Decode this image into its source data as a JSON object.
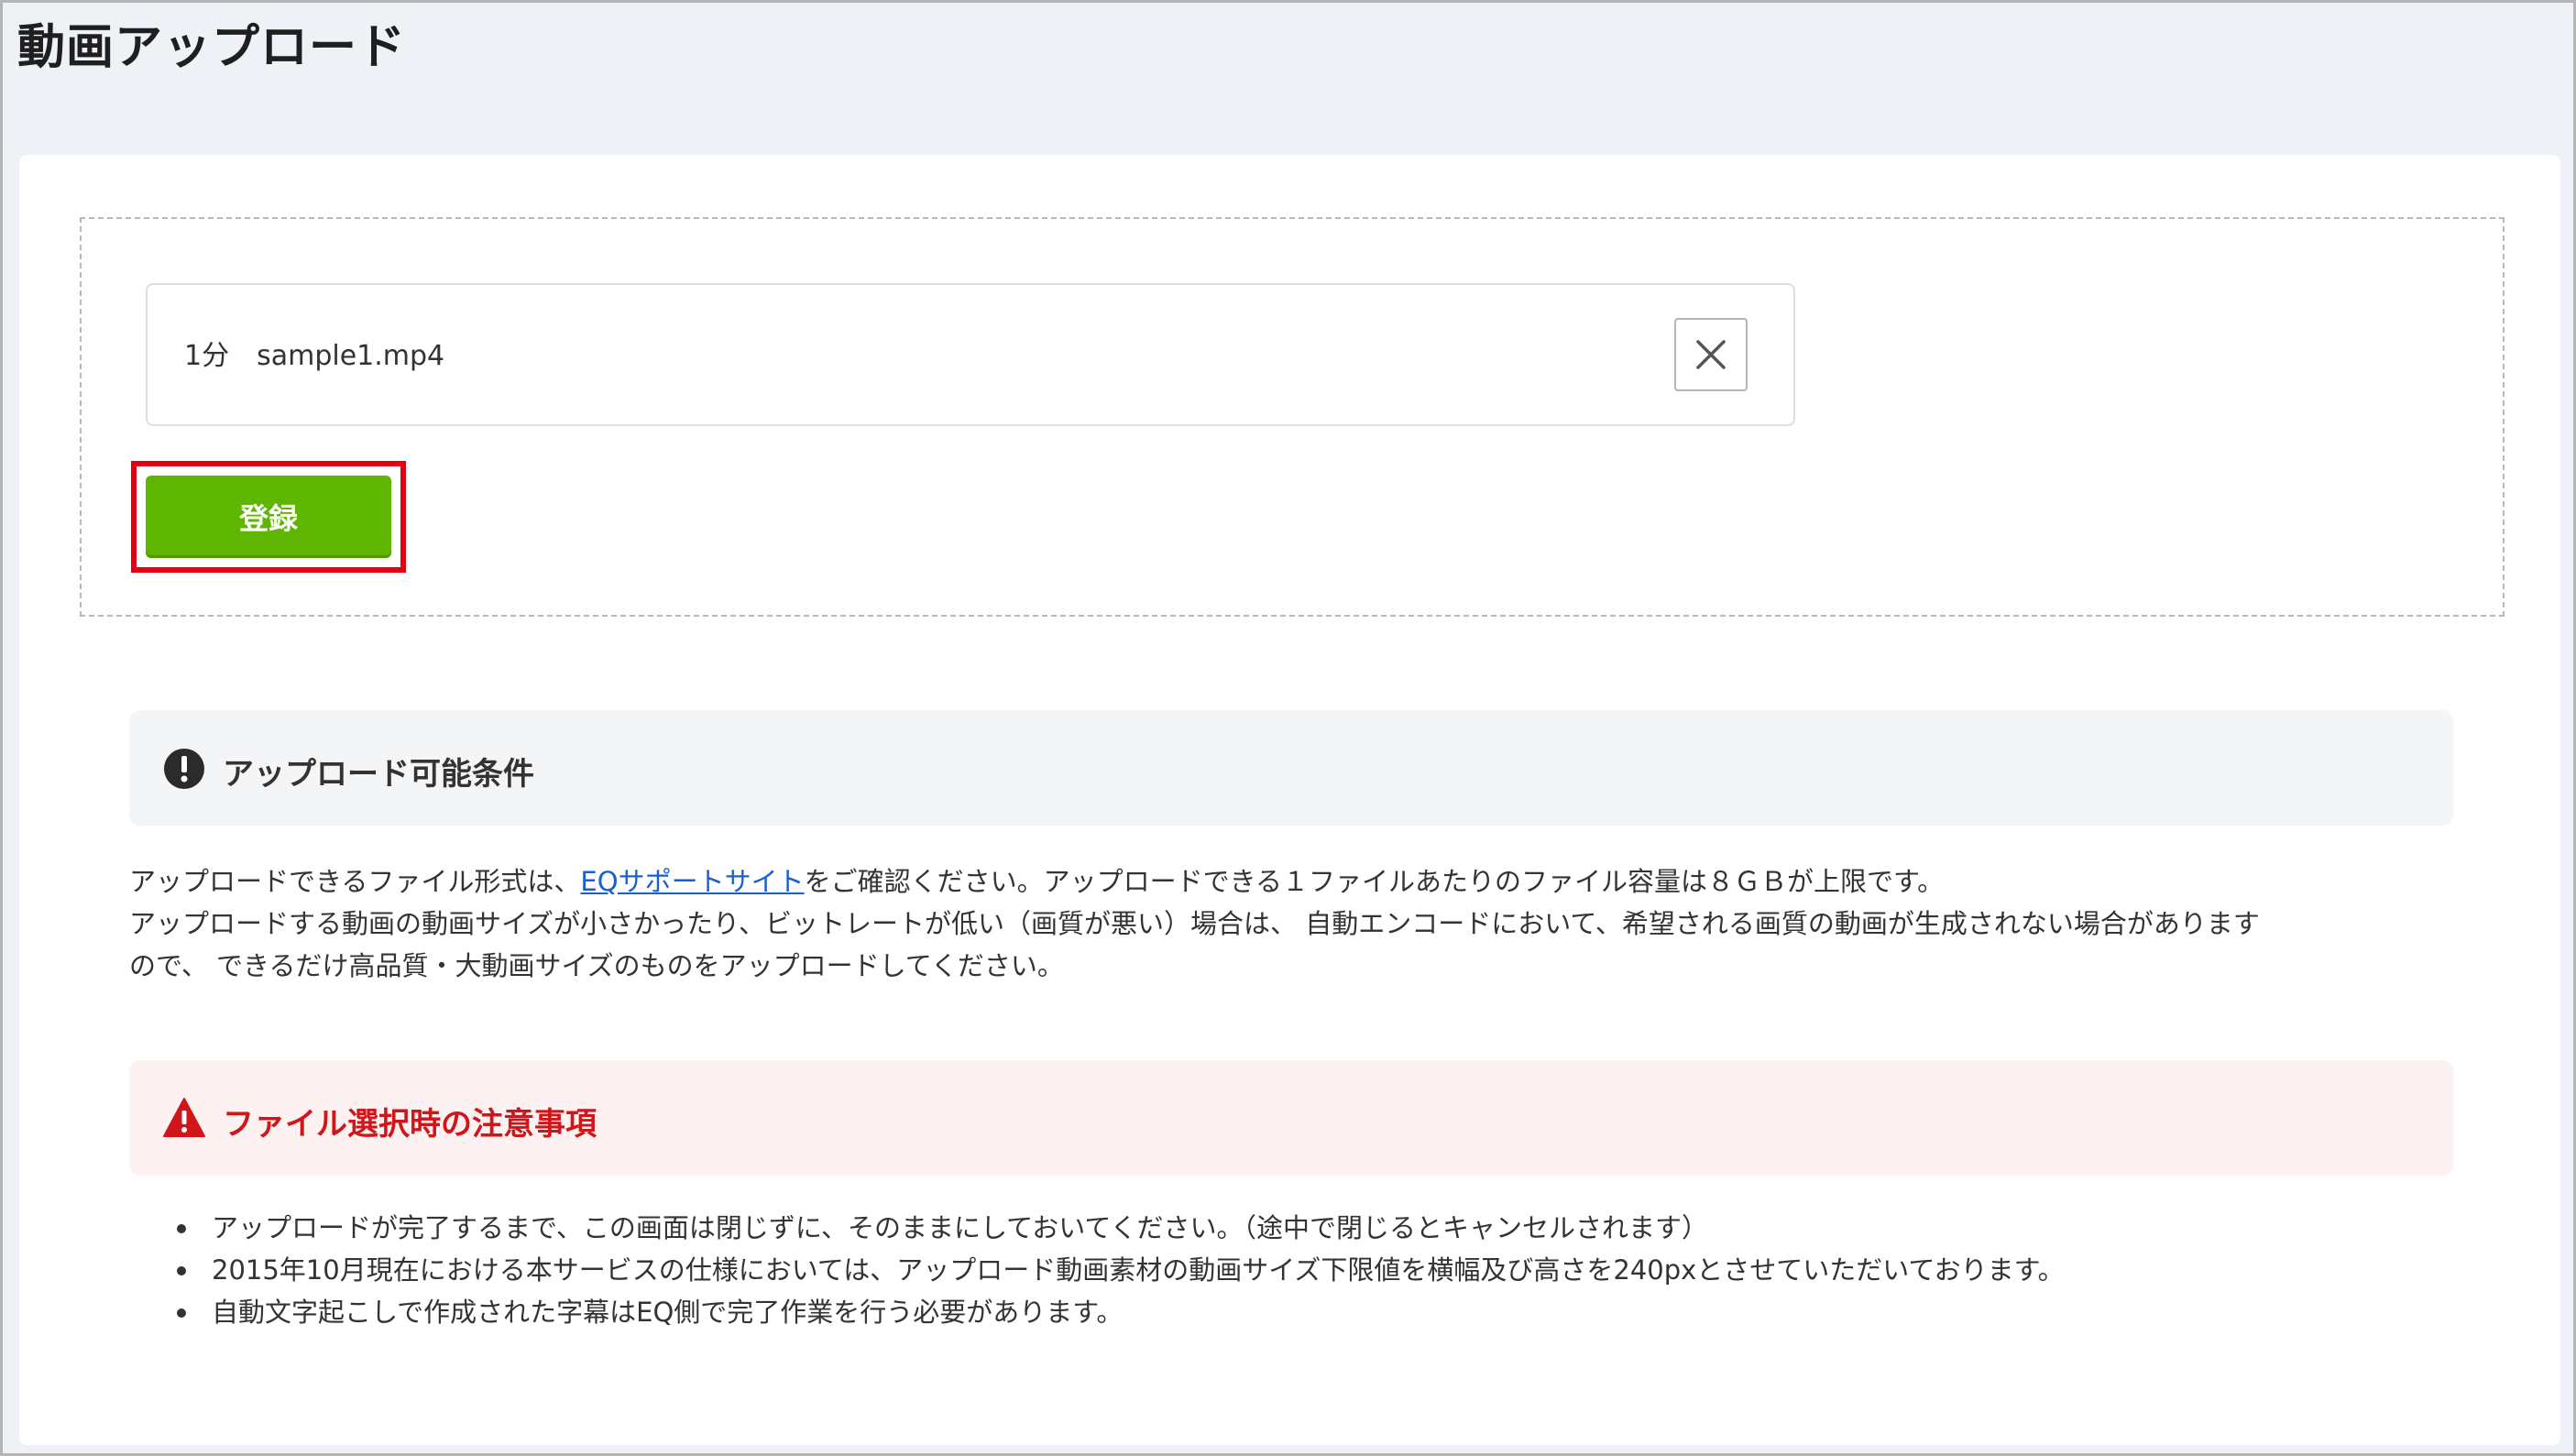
{
  "page": {
    "title": "動画アップロード"
  },
  "upload": {
    "file": {
      "duration": "1分",
      "name": "sample1.mp4"
    },
    "remove_icon": "close-icon",
    "register_label": "登録",
    "register_color": "#5fb600",
    "highlight_color": "#e60012"
  },
  "conditions": {
    "icon": "exclamation-circle-icon",
    "title": "アップロード可能条件",
    "line1_before": "アップロードできるファイル形式は、",
    "line1_link": "EQサポートサイト",
    "line1_after": "をご確認ください。アップロードできる１ファイルあたりのファイル容量は８ＧＢが上限です。",
    "line2": "アップロードする動画の動画サイズが小さかったり、ビットレートが低い（画質が悪い）場合は、 自動エンコードにおいて、希望される画質の動画が生成されない場合があります",
    "line3": "ので、 できるだけ高品質・大動画サイズのものをアップロードしてください。"
  },
  "caution": {
    "icon": "warning-triangle-icon",
    "title": "ファイル選択時の注意事項",
    "title_color": "#d0161b",
    "items": [
      "アップロードが完了するまで、この画面は閉じずに、そのままにしておいてください。（途中で閉じるとキャンセルされます）",
      "2015年10月現在における本サービスの仕様においては、アップロード動画素材の動画サイズ下限値を横幅及び高さを240pxとさせていただいております。",
      "自動文字起こしで作成された字幕はEQ側で完了作業を行う必要があります。"
    ]
  }
}
